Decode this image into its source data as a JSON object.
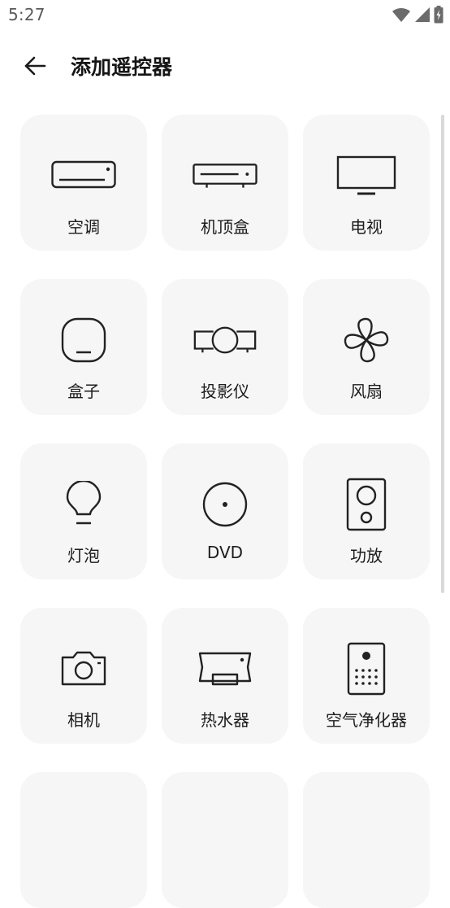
{
  "status_bar": {
    "time": "5:27",
    "icons": [
      "wifi-icon",
      "signal-icon",
      "battery-icon"
    ]
  },
  "header": {
    "title": "添加遥控器",
    "back_icon": "arrow-left-icon"
  },
  "colors": {
    "tile_background": "#f6f6f6",
    "icon_stroke": "#222222",
    "scrollbar": "#d9d9d9"
  },
  "devices": [
    {
      "label": "空调",
      "icon": "air-conditioner-icon"
    },
    {
      "label": "机顶盒",
      "icon": "set-top-box-icon"
    },
    {
      "label": "电视",
      "icon": "tv-icon"
    },
    {
      "label": "盒子",
      "icon": "box-icon"
    },
    {
      "label": "投影仪",
      "icon": "projector-icon"
    },
    {
      "label": "风扇",
      "icon": "fan-icon"
    },
    {
      "label": "灯泡",
      "icon": "light-bulb-icon"
    },
    {
      "label": "DVD",
      "icon": "dvd-icon"
    },
    {
      "label": "功放",
      "icon": "amplifier-icon"
    },
    {
      "label": "相机",
      "icon": "camera-icon"
    },
    {
      "label": "热水器",
      "icon": "water-heater-icon"
    },
    {
      "label": "空气净化器",
      "icon": "air-purifier-icon"
    }
  ]
}
